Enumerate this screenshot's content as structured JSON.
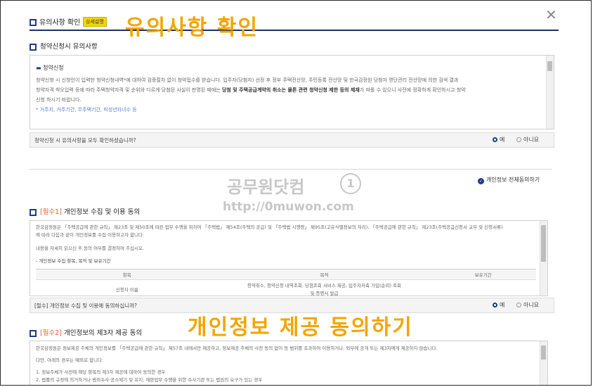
{
  "header": {
    "title": "유의사항 확인",
    "badge": "상세설명",
    "overlay_title": "유의사항 확인",
    "close_symbol": "✕"
  },
  "section1": {
    "title": "청약신청시 유의사항",
    "subheading": "청약신청",
    "paragraph_line1": "청약신청 시 신청인이 입력한 청약신청내역*에 대하여 검증절차 없이 청약접수를 받습니다. 입주자(당첨자) 선정 후 정부 주택전산망, 주민등록 전산망 및 한국감정원 당첨자 명단관리 전산망에 의한 검색 결과",
    "paragraph_line2_a": "청약자격 착오입력 등에 따라 주택청약자격 및 순위와 다르게 당첨된 사실이 판명된 때에는 ",
    "paragraph_line2_b": "당첨 및 주택공급계약의 취소는 물론 관련 청약신청 제한 등의 제재",
    "paragraph_line2_c": "가 따를 수 있으니 사전에 정확하게 확인하시고 청약",
    "paragraph_line3": "신청 하시기 바랍니다.",
    "note": "* 거주지, 거주기간, 무주택기간, 미성년자녀수 등",
    "question": "청약신청 시 유의사항을 모두 확인하셨습니까?",
    "yes": "예",
    "no": "아니요"
  },
  "agree_all": "개인정보 전체동의하기",
  "watermark": {
    "line1": "공무원닷컴",
    "badge": "1",
    "line2": "http://0muwon.com"
  },
  "section2": {
    "required": "[필수1]",
    "title": "개인정보 수집 및 이용 동의",
    "text_line1": "한국감정원은 「주택공급에 관한 규칙」 제23조 및 제50조에 따른 업무 수행을 위하여 「주택법」 제54조(주택의 공급) 및 「주택법 시행령」 제95조(고유식별정보의 처리), 「주택공급에 관한 규칙」 제23조(주택공급신청서 교부 및 신청서류)",
    "text_line2": "에 따라 다음과 같이 개인정보를 수집·이용하고자 합니다.",
    "text_line3": "내용을 자세히 읽으신 후 동의 여부를 결정하여 주십시오.",
    "list_label": "- 개인정보 수집 항목, 목적 및 보유기간",
    "table": {
      "headers": [
        "항목",
        "목적",
        "보유기간"
      ],
      "rows": [
        [
          "신청자 이름",
          "청약취소, 청약신청 내역조회, 당첨조회 서비스 제공, 입주자저축 가입(순위) 조회 및 증명서 발급",
          ""
        ]
      ]
    },
    "question": "[필수] 개인정보 수집 및 이용에 동의하십니까?",
    "yes": "예",
    "no": "아니요"
  },
  "overlay2": "개인정보 제공 동의하기",
  "section3": {
    "required": "[필수2]",
    "title": "개인정보의 제3자 제공 동의",
    "text_line1": "한국감정원은 정보제공 주체의 개인정보를 「주택공급에 관한 규칙」 제57조 내에서만 제공하고, 정보제공 주체의 사전 동의 없이 동 범위를 초과하여 이용하거나, 외부에 공개 또는 제3자에게 제공하지 않습니다.",
    "text_line2": "다만, 아래의 경우는 예외로 합니다.",
    "item1": "1. 정보주체가 사전에 해당 항목의 제3자 제공에 대하여 동의한 경우",
    "item2": "2. 법률의 규정에 의거하거나 범죄수사·공소제기 및 유지, 재판업무 수행을 위한 수사기관 또는 법원의 요구가 있는 경우"
  },
  "colors": {
    "navy": "#1f3a8a",
    "overlay": "#f3a500",
    "required": "#d9642b",
    "badge": "#f4d600"
  }
}
